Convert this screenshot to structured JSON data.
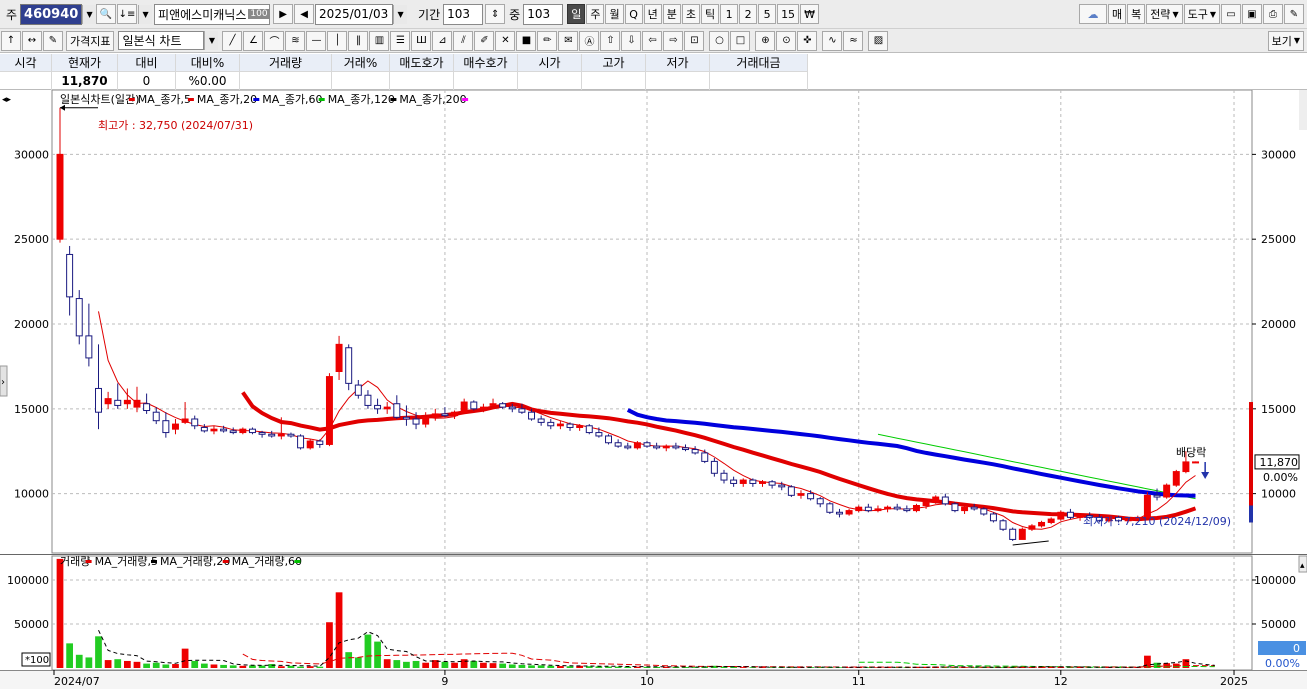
{
  "toolbar1": {
    "label_code": "주",
    "code": "460940",
    "name": "피앤에스미캐닉스",
    "name_badge": "100",
    "date": "2025/01/03",
    "period_label": "기간",
    "period_value": "103",
    "center_label": "중",
    "center_value": "103",
    "periods": [
      "일",
      "주",
      "월",
      "Q",
      "년",
      "분",
      "초",
      "틱",
      "1",
      "2",
      "5",
      "15",
      "₩"
    ],
    "right_buttons": [
      "매",
      "복",
      "전략",
      "도구"
    ]
  },
  "toolbar2": {
    "indicator_btn": "가격지표",
    "chart_type": "일본식 차트",
    "view_btn": "보기"
  },
  "quote": {
    "headers": [
      "시각",
      "현재가",
      "대비",
      "대비%",
      "거래량",
      "거래%",
      "매도호가",
      "매수호가",
      "시가",
      "고가",
      "저가",
      "거래대금"
    ],
    "values": [
      "",
      "11,870",
      "0",
      "%0.00",
      "",
      "",
      "",
      "",
      "",
      "",
      "",
      ""
    ]
  },
  "legend_price": {
    "title": "일본식차트(일간)",
    "items": [
      {
        "label": "MA_종가,5",
        "color": "#e00000"
      },
      {
        "label": "MA_종가,20",
        "color": "#e00000"
      },
      {
        "label": "MA_종가,60",
        "color": "#0000dd"
      },
      {
        "label": "MA_종가,120",
        "color": "#00c000"
      },
      {
        "label": "MA_종가,200",
        "color": "#000000"
      }
    ],
    "end_color": "#ff00ff"
  },
  "legend_volume": {
    "title": "거래량",
    "items": [
      {
        "label": "MA_거래량,5",
        "color": "#e00000"
      },
      {
        "label": "MA_거래량,20",
        "color": "#000000"
      },
      {
        "label": "MA_거래량,60",
        "color": "#e00000"
      }
    ],
    "end_color": "#00c000"
  },
  "annotations": {
    "high": "최고가 : 32,750 (2024/07/31)",
    "low": "최저가 : 7,210 (2024/12/09)",
    "dividend": "배당락"
  },
  "price_badges": {
    "current": "11,870",
    "pct": "0.00%"
  },
  "volume_badges": {
    "current": "0",
    "pct": "0.00%",
    "unit": "*100"
  },
  "chart_data": [
    {
      "type": "candlestick",
      "title": "일본식차트(일간)",
      "y_ticks": [
        10000,
        15000,
        20000,
        25000,
        30000
      ],
      "y_tick_labels": [
        "10000",
        "15000",
        "20000",
        "25000",
        "30000"
      ],
      "ylim": [
        6500,
        33500
      ],
      "x_labels": [
        "2024/07",
        "9",
        "10",
        "11",
        "12",
        "2025"
      ],
      "x_label_index": [
        0,
        40,
        61,
        83,
        104,
        122
      ],
      "n_bars": 125,
      "ohlc": [
        [
          25000,
          32750,
          24800,
          30000
        ],
        [
          24100,
          24600,
          20500,
          21600
        ],
        [
          21500,
          22000,
          18800,
          19300
        ],
        [
          19300,
          21200,
          17500,
          18000
        ],
        [
          16200,
          18800,
          13800,
          14800
        ],
        [
          15300,
          16000,
          15000,
          15600
        ],
        [
          15500,
          16500,
          15000,
          15200
        ],
        [
          15300,
          16200,
          15000,
          15500
        ],
        [
          15100,
          16300,
          14800,
          15500
        ],
        [
          15300,
          15900,
          14700,
          14900
        ],
        [
          14800,
          15100,
          14100,
          14300
        ],
        [
          14300,
          14800,
          13300,
          13600
        ],
        [
          13800,
          14400,
          13500,
          14100
        ],
        [
          14200,
          15400,
          14100,
          14400
        ],
        [
          14400,
          14600,
          13800,
          14000
        ],
        [
          13900,
          14100,
          13600,
          13700
        ],
        [
          13700,
          14000,
          13500,
          13800
        ],
        [
          13800,
          14000,
          13600,
          13700
        ],
        [
          13700,
          13900,
          13500,
          13600
        ],
        [
          13600,
          13900,
          13500,
          13800
        ],
        [
          13800,
          13900,
          13500,
          13600
        ],
        [
          13600,
          13700,
          13300,
          13500
        ],
        [
          13500,
          13700,
          13300,
          13400
        ],
        [
          13400,
          14500,
          13200,
          13500
        ],
        [
          13500,
          13600,
          13300,
          13400
        ],
        [
          13400,
          13500,
          12600,
          12700
        ],
        [
          12700,
          13200,
          12600,
          13100
        ],
        [
          13100,
          13200,
          12700,
          12900
        ],
        [
          12900,
          17100,
          12800,
          16900
        ],
        [
          17200,
          19300,
          16700,
          18800
        ],
        [
          18600,
          18800,
          16100,
          16500
        ],
        [
          16400,
          16700,
          15600,
          15800
        ],
        [
          15800,
          16100,
          15000,
          15200
        ],
        [
          15200,
          15600,
          14700,
          15000
        ],
        [
          15000,
          15400,
          14700,
          15100
        ],
        [
          15300,
          15800,
          14400,
          14500
        ],
        [
          14500,
          15200,
          14000,
          14400
        ],
        [
          14400,
          14800,
          13800,
          14100
        ],
        [
          14100,
          14800,
          13900,
          14500
        ],
        [
          14500,
          15000,
          14300,
          14700
        ],
        [
          14700,
          15100,
          14500,
          14600
        ],
        [
          14600,
          14900,
          14400,
          14800
        ],
        [
          14800,
          15600,
          14700,
          15400
        ],
        [
          15400,
          15500,
          14900,
          15000
        ],
        [
          15000,
          15300,
          14800,
          15100
        ],
        [
          15200,
          15600,
          15000,
          15300
        ],
        [
          15300,
          15400,
          15000,
          15100
        ],
        [
          15100,
          15300,
          14800,
          15000
        ],
        [
          15000,
          15300,
          14700,
          14800
        ],
        [
          14800,
          15000,
          14300,
          14400
        ],
        [
          14400,
          14600,
          14000,
          14200
        ],
        [
          14200,
          14400,
          13800,
          14000
        ],
        [
          14000,
          14300,
          13800,
          14100
        ],
        [
          14100,
          14200,
          13700,
          13900
        ],
        [
          13900,
          14100,
          13700,
          14000
        ],
        [
          14000,
          14100,
          13500,
          13600
        ],
        [
          13600,
          13900,
          13300,
          13400
        ],
        [
          13400,
          13500,
          12900,
          13000
        ],
        [
          13000,
          13200,
          12700,
          12800
        ],
        [
          12800,
          13000,
          12600,
          12700
        ],
        [
          12700,
          13100,
          12600,
          13000
        ],
        [
          13000,
          13100,
          12700,
          12800
        ],
        [
          12800,
          13000,
          12600,
          12700
        ],
        [
          12700,
          12900,
          12500,
          12800
        ],
        [
          12800,
          13000,
          12600,
          12700
        ],
        [
          12700,
          12900,
          12500,
          12600
        ],
        [
          12600,
          12800,
          12300,
          12400
        ],
        [
          12400,
          12600,
          11800,
          11900
        ],
        [
          11900,
          12100,
          11000,
          11200
        ],
        [
          11200,
          11400,
          10600,
          10800
        ],
        [
          10800,
          11000,
          10400,
          10600
        ],
        [
          10600,
          10900,
          10400,
          10800
        ],
        [
          10800,
          10900,
          10400,
          10600
        ],
        [
          10600,
          10800,
          10400,
          10700
        ],
        [
          10700,
          10800,
          10300,
          10500
        ],
        [
          10500,
          10700,
          10200,
          10400
        ],
        [
          10400,
          10500,
          9800,
          9900
        ],
        [
          9900,
          10200,
          9700,
          10000
        ],
        [
          10000,
          10200,
          9600,
          9700
        ],
        [
          9700,
          9800,
          9200,
          9400
        ],
        [
          9400,
          9500,
          8800,
          8900
        ],
        [
          8900,
          9100,
          8600,
          8800
        ],
        [
          8800,
          9100,
          8700,
          9000
        ],
        [
          9000,
          9300,
          8900,
          9200
        ],
        [
          9200,
          9400,
          8900,
          9000
        ],
        [
          9000,
          9300,
          8900,
          9100
        ],
        [
          9100,
          9300,
          8900,
          9200
        ],
        [
          9200,
          9400,
          9000,
          9100
        ],
        [
          9100,
          9300,
          8900,
          9000
        ],
        [
          9000,
          9400,
          8900,
          9300
        ],
        [
          9300,
          9600,
          9100,
          9500
        ],
        [
          9500,
          9900,
          9400,
          9800
        ],
        [
          9800,
          10000,
          9300,
          9400
        ],
        [
          9400,
          9500,
          8900,
          9000
        ],
        [
          9000,
          9300,
          8800,
          9200
        ],
        [
          9200,
          9400,
          9000,
          9100
        ],
        [
          9100,
          9200,
          8700,
          8800
        ],
        [
          8800,
          8900,
          8300,
          8400
        ],
        [
          8400,
          8500,
          7800,
          7900
        ],
        [
          7900,
          8000,
          7210,
          7300
        ],
        [
          7300,
          8000,
          7300,
          7900
        ],
        [
          7900,
          8200,
          7800,
          8100
        ],
        [
          8100,
          8400,
          8000,
          8300
        ],
        [
          8300,
          8600,
          8200,
          8500
        ],
        [
          8500,
          9000,
          8400,
          8900
        ],
        [
          8900,
          9100,
          8500,
          8600
        ],
        [
          8600,
          8800,
          8400,
          8700
        ],
        [
          8700,
          8900,
          8500,
          8600
        ],
        [
          8600,
          8800,
          8300,
          8400
        ],
        [
          8400,
          8700,
          8300,
          8600
        ],
        [
          8600,
          8700,
          8300,
          8400
        ],
        [
          8400,
          8600,
          8300,
          8500
        ],
        [
          8500,
          8700,
          8400,
          8600
        ],
        [
          8600,
          10100,
          8500,
          9900
        ],
        [
          9900,
          10300,
          9600,
          9800
        ],
        [
          9800,
          10600,
          9700,
          10500
        ],
        [
          10500,
          11400,
          10400,
          11300
        ],
        [
          11300,
          12500,
          11200,
          11870
        ],
        [
          11870,
          11900,
          11850,
          11870
        ]
      ]
    },
    {
      "type": "bar",
      "title": "거래량",
      "y_ticks": [
        50000,
        100000
      ],
      "y_tick_labels": [
        "50000",
        "100000"
      ],
      "ylim": [
        0,
        125000
      ],
      "values": [
        124000,
        28000,
        15000,
        12000,
        36000,
        9000,
        10000,
        8000,
        7000,
        5000,
        6000,
        4000,
        4500,
        22000,
        8000,
        5000,
        4000,
        3500,
        3000,
        2500,
        3000,
        2800,
        4500,
        2000,
        2500,
        1500,
        2000,
        1500,
        52000,
        86000,
        18000,
        12000,
        38000,
        30000,
        10000,
        9000,
        7000,
        8000,
        6000,
        9000,
        7000,
        6000,
        10000,
        8000,
        6000,
        5500,
        5000,
        4000,
        3500,
        3000,
        3000,
        2500,
        2200,
        2000,
        2500,
        2000,
        1800,
        1600,
        1500,
        1400,
        1500,
        1300,
        1200,
        1300,
        1200,
        1100,
        1000,
        1800,
        2500,
        1500,
        1200,
        1000,
        900,
        1000,
        800,
        900,
        1200,
        900,
        1000,
        1100,
        900,
        800,
        700,
        800,
        900,
        800,
        700,
        800,
        900,
        1000,
        1200,
        1600,
        1400,
        1100,
        900,
        800,
        700,
        800,
        1000,
        1500,
        1400,
        1200,
        1500,
        1300,
        1100,
        1000,
        900,
        800,
        800,
        700,
        900,
        800,
        1000,
        14000,
        6000,
        5500,
        5000,
        10000,
        0,
        0,
        0
      ]
    }
  ]
}
